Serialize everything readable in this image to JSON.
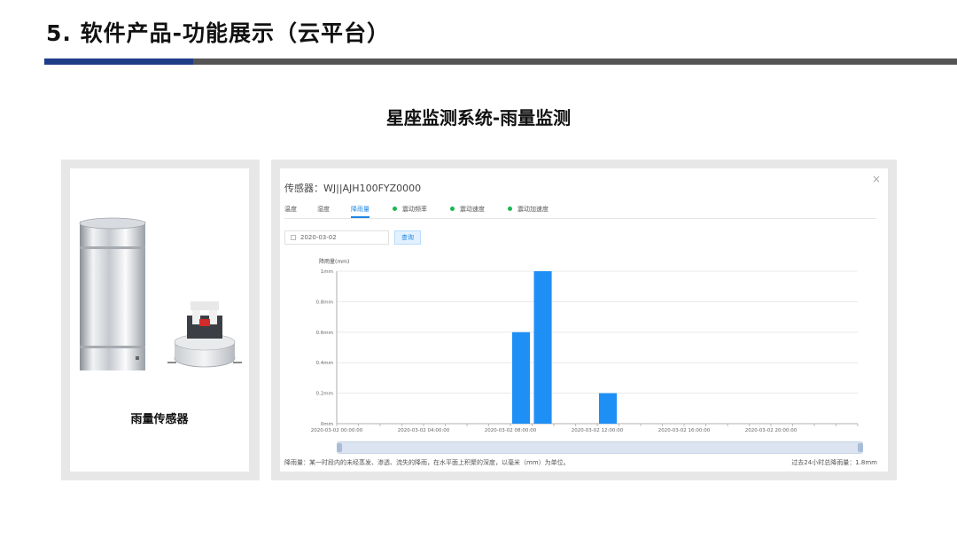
{
  "slide": {
    "title": "5. 软件产品-功能展示（云平台）",
    "subtitle": "星座监测系统-雨量监测"
  },
  "left_panel": {
    "caption": "雨量传感器"
  },
  "app": {
    "sensor_title": "传感器：WJ||AJH100FYZ0000",
    "tabs": [
      {
        "label": "温度",
        "active": false,
        "dot": false
      },
      {
        "label": "湿度",
        "active": false,
        "dot": false
      },
      {
        "label": "降雨量",
        "active": true,
        "dot": false
      },
      {
        "label": "震动频率",
        "active": false,
        "dot": true
      },
      {
        "label": "震动速度",
        "active": false,
        "dot": true
      },
      {
        "label": "震动加速度",
        "active": false,
        "dot": true
      }
    ],
    "date_value": "2020-03-02",
    "query_label": "查询",
    "footnote": "降雨量：某一时段内的未经蒸发、渗透、流失的降雨，在水平面上积聚的深度，以毫米（mm）为单位。",
    "total": "过去24小时总降雨量：1.8mm",
    "accent_color": "#1e88e5",
    "status_dot_color": "#19b84f"
  },
  "chart_data": {
    "type": "bar",
    "ylabel": "降雨量(mm)",
    "ylim": [
      0,
      1
    ],
    "y_ticks": [
      "0mm",
      "0.2mm",
      "0.4mm",
      "0.6mm",
      "0.8mm",
      "1mm"
    ],
    "x_tick_labels": [
      "2020-03-02 00:00:00",
      "2020-03-02 04:00:00",
      "2020-03-02 08:00:00",
      "2020-03-02 12:00:00",
      "2020-03-02 16:00:00",
      "2020-03-02 20:00:00"
    ],
    "x_hours": [
      0,
      4,
      8,
      12,
      16,
      20
    ],
    "bars": [
      {
        "hour": 8,
        "value": 0.6
      },
      {
        "hour": 9,
        "value": 1.0
      },
      {
        "hour": 12,
        "value": 0.2
      }
    ],
    "bar_color": "#1e90f5",
    "grid": true
  }
}
